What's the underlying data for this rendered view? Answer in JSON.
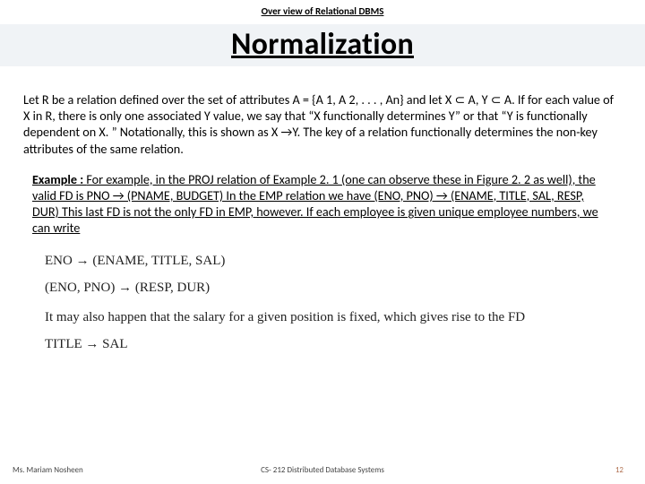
{
  "header": {
    "overview": "Over view of Relational DBMS",
    "title": "Normalization"
  },
  "body": {
    "para1": "Let R be a relation defined over the set of attributes A = {A 1, A 2, . . . , An} and let X ⊂ A, Y ⊂ A. If for each value of X in R, there is only one associated Y value, we say that “X functionally determines Y” or that “Y is functionally dependent on X. ” Notationally, this is shown as X →Y. The key of a relation functionally determines the non-key attributes of the same relation.",
    "example_label": "Example : ",
    "example_text": "For example, in the PROJ relation of Example 2. 1 (one can observe these in Figure 2. 2 as well), the valid FD is PNO → (PNAME, BUDGET) In the EMP relation we have (ENO, PNO) → (ENAME, TITLE, SAL, RESP, DUR) This last FD is not the only FD in EMP, however. If each employee is given unique employee numbers, we can write",
    "formula1": "ENO → (ENAME, TITLE, SAL)",
    "formula2": "(ENO, PNO) → (RESP, DUR)",
    "followup": "It may also happen that the salary for a given position is fixed, which gives rise to the FD",
    "formula3": "TITLE → SAL"
  },
  "footer": {
    "author": "Ms. Mariam Nosheen",
    "course": "CS- 212 Distributed Database Systems",
    "page": "12"
  }
}
